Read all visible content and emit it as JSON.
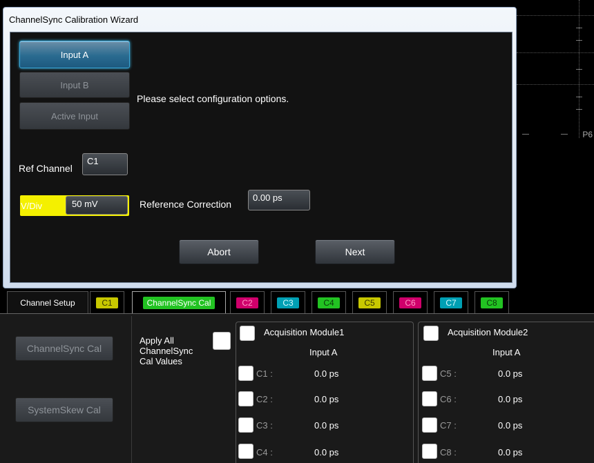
{
  "dialog": {
    "title": "ChannelSync Calibration Wizard",
    "input_a": "Input A",
    "input_b": "Input B",
    "active_input": "Active Input",
    "message": "Please select configuration options.",
    "ref_channel_label": "Ref Channel",
    "ref_channel_value": "C1",
    "vdiv_label": "V/Div",
    "vdiv_value": "50 mV",
    "ref_correction_label": "Reference Correction",
    "ref_correction_value": "0.00 ps",
    "abort": "Abort",
    "next": "Next"
  },
  "scope": {
    "p_label": "P6"
  },
  "tabs": [
    {
      "label": "Channel Setup",
      "color": ""
    },
    {
      "label": "C1",
      "color": "#c8c800"
    },
    {
      "label": "ChannelSync Cal",
      "color": "#22c322"
    },
    {
      "label": "C2",
      "color": "#d0006b"
    },
    {
      "label": "C3",
      "color": "#00a0b4"
    },
    {
      "label": "C4",
      "color": "#22c322"
    },
    {
      "label": "C5",
      "color": "#c8c800"
    },
    {
      "label": "C6",
      "color": "#d0006b"
    },
    {
      "label": "C7",
      "color": "#00a0b4"
    },
    {
      "label": "C8",
      "color": "#22c322"
    }
  ],
  "panel": {
    "channelsync_cal": "ChannelSync Cal",
    "systemskew_cal": "SystemSkew Cal",
    "apply_all": [
      "Apply All",
      "ChannelSync",
      "Cal Values"
    ],
    "modules": [
      {
        "title": "Acquisition Module1",
        "input": "Input A",
        "channels": [
          {
            "name": "C1 :",
            "value": "0.0 ps"
          },
          {
            "name": "C2 :",
            "value": "0.0 ps"
          },
          {
            "name": "C3 :",
            "value": "0.0 ps"
          },
          {
            "name": "C4 :",
            "value": "0.0 ps"
          }
        ]
      },
      {
        "title": "Acquisition Module2",
        "input": "Input A",
        "channels": [
          {
            "name": "C5 :",
            "value": "0.0 ps"
          },
          {
            "name": "C6 :",
            "value": "0.0 ps"
          },
          {
            "name": "C7 :",
            "value": "0.0 ps"
          },
          {
            "name": "C8 :",
            "value": "0.0 ps"
          }
        ]
      }
    ]
  }
}
